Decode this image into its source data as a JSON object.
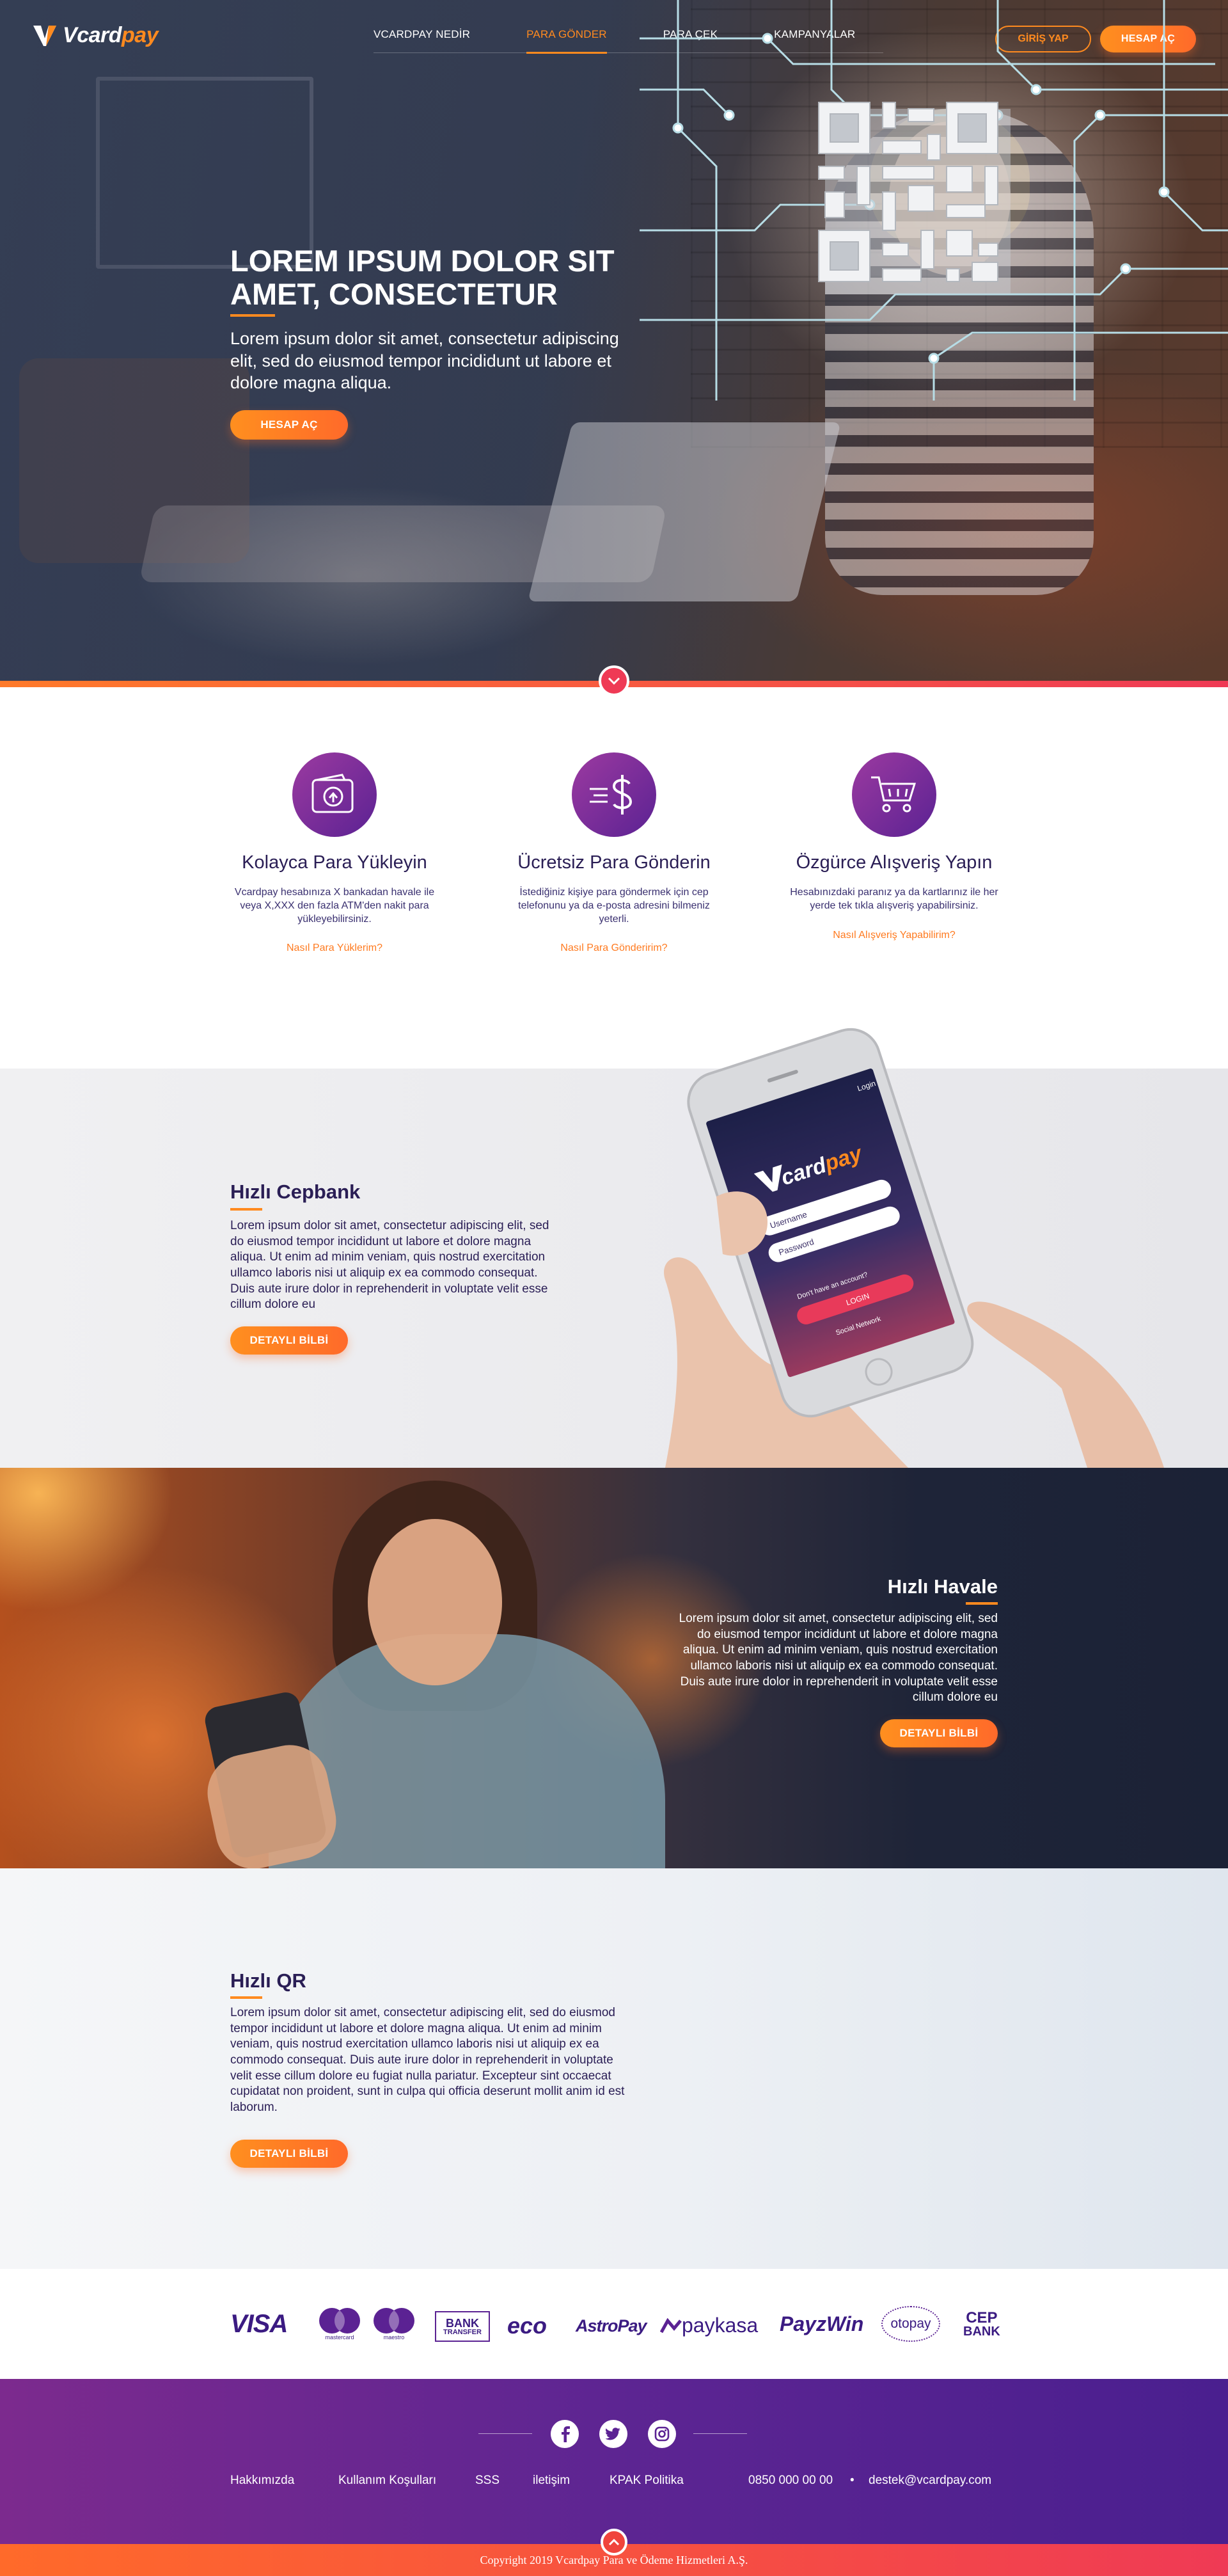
{
  "header": {
    "logo_v": "V",
    "logo_card": "card",
    "logo_pay": "pay",
    "nav": [
      "VCARDPAY NEDİR",
      "PARA GÖNDER",
      "PARA ÇEK",
      "KAMPANYALAR"
    ],
    "login_label": "GİRİŞ YAP",
    "register_label": "HESAP AÇ"
  },
  "hero": {
    "title": "LOREM IPSUM DOLOR SIT AMET, CONSECTETUR",
    "subtitle": "Lorem ipsum dolor sit amet, consectetur adipiscing elit, sed do eiusmod tempor incididunt ut labore et dolore magna aliqua.",
    "cta_label": "HESAP AÇ"
  },
  "features": [
    {
      "icon": "wallet-upload-icon",
      "title": "Kolayca Para Yükleyin",
      "text": "Vcardpay hesabınıza X bankadan havale ile veya X,XXX den fazla ATM'den nakit para yükleyebilirsiniz.",
      "link": "Nasıl Para Yüklerim?"
    },
    {
      "icon": "fast-money-icon",
      "title": "Ücretsiz Para Gönderin",
      "text": "İstediğiniz kişiye para göndermek için cep telefonunu ya da e-posta adresini bilmeniz yeterli.",
      "link": "Nasıl Para Gönderirim?"
    },
    {
      "icon": "shopping-cart-icon",
      "title": "Özgürce Alışveriş Yapın",
      "text": "Hesabınızdaki paranız ya da kartlarınız ile her yerde tek tıkla alışveriş yapabilirsiniz.",
      "link": "Nasıl Alışveriş Yapabilirim?"
    }
  ],
  "cepbank": {
    "title": "Hızlı Cepbank",
    "text": "Lorem ipsum dolor sit amet, consectetur adipiscing elit, sed do eiusmod tempor incididunt ut labore et dolore magna aliqua. Ut enim ad minim veniam, quis nostrud exercitation ullamco laboris nisi ut aliquip ex ea commodo consequat. Duis aute irure dolor in reprehenderit in voluptate velit esse cillum dolore eu",
    "button": "DETAYLI BİLBİ",
    "phone": {
      "login": "Login",
      "logo_v": "V",
      "logo_card": "card",
      "logo_pay": "pay",
      "username_placeholder": "Username",
      "password_placeholder": "Password",
      "forgot": "Don't have an account?",
      "login_button": "LOGIN",
      "network": "Social Network"
    }
  },
  "havale": {
    "title": "Hızlı Havale",
    "text": "Lorem ipsum dolor sit amet, consectetur adipiscing elit, sed do eiusmod tempor incididunt ut labore et dolore magna aliqua. Ut enim ad minim veniam, quis nostrud exercitation ullamco laboris nisi ut aliquip ex ea commodo consequat. Duis aute irure dolor in reprehenderit in voluptate velit esse cillum dolore eu",
    "button": "DETAYLI BİLBİ"
  },
  "qr": {
    "title": "Hızlı QR",
    "text": "Lorem ipsum dolor sit amet, consectetur adipiscing elit, sed do eiusmod tempor incididunt ut labore et dolore magna aliqua. Ut enim ad minim veniam, quis nostrud exercitation ullamco laboris nisi ut aliquip ex ea commodo consequat. Duis aute irure dolor in reprehenderit in voluptate velit esse cillum dolore eu fugiat nulla pariatur. Excepteur sint occaecat cupidatat non proident, sunt in culpa qui officia deserunt mollit anim id est laborum.",
    "button": "DETAYLI BİLBİ"
  },
  "payments": {
    "visa": "VISA",
    "mastercard": "mastercard",
    "maestro": "maestro",
    "bank_transfer_1": "BANK",
    "bank_transfer_2": "TRANSFER",
    "eco": "eco",
    "astropay": "AstroPay",
    "paykasa": "paykasa",
    "payzwin": "PayzWin",
    "otopay": "otopay",
    "cepbank_1": "CEP",
    "cepbank_2": "BANK"
  },
  "footer": {
    "social": [
      "facebook-icon",
      "twitter-icon",
      "instagram-icon"
    ],
    "links": [
      "Hakkımızda",
      "Kullanım Koşulları",
      "SSS",
      "iletişim",
      "KPAK Politika"
    ],
    "phone": "0850 000 00 00",
    "separator": "•",
    "email": "destek@vcardpay.com",
    "copyright": "Copyright 2019 Vcardpay Para ve Ödeme Hizmetleri A.Ş."
  },
  "colors": {
    "brand_orange": "#ff8a1f",
    "brand_purple": "#5b2293",
    "text_navy": "#2a1e55",
    "accent_red": "#ef3a55"
  }
}
